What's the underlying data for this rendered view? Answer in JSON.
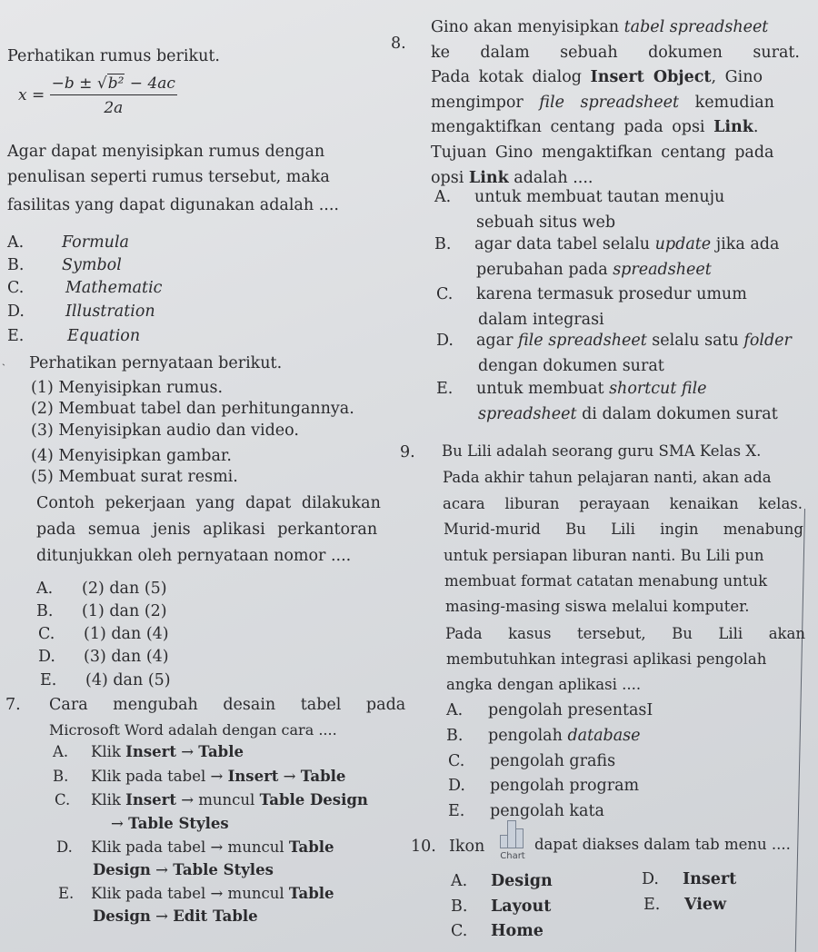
{
  "q6_intro": {
    "prompt": "Perhatikan rumus berikut.",
    "formula": {
      "lhs": "x =",
      "numerator_pre": "−b ± ",
      "sqrt_term": "b²",
      "numerator_post": " − 4ac",
      "denominator": "2a"
    },
    "question_lines": [
      "Agar dapat menyisipkan rumus dengan",
      "penulisan seperti rumus tersebut, maka",
      "fasilitas yang dapat digunakan adalah ...."
    ],
    "options": [
      {
        "letter": "A.",
        "text": "Formula"
      },
      {
        "letter": "B.",
        "text": "Symbol"
      },
      {
        "letter": "C.",
        "text": "Mathematic"
      },
      {
        "letter": "D.",
        "text": "Illustration"
      },
      {
        "letter": "E.",
        "text": "Equation"
      }
    ]
  },
  "q6": {
    "number": "ˎ",
    "prompt": "Perhatikan pernyataan berikut.",
    "statements": [
      "(1)  Menyisipkan rumus.",
      "(2)  Membuat tabel dan perhitungannya.",
      "(3)  Menyisipkan audio dan video.",
      "(4)  Menyisipkan gambar.",
      "(5)  Membuat surat resmi."
    ],
    "question_lines": [
      "Contoh pekerjaan yang dapat dilakukan",
      "pada semua jenis aplikasi perkantoran",
      "ditunjukkan oleh pernyataan nomor ...."
    ],
    "options": [
      {
        "letter": "A.",
        "text": "(2) dan (5)"
      },
      {
        "letter": "B.",
        "text": "(1) dan (2)"
      },
      {
        "letter": "C.",
        "text": "(1) dan (4)"
      },
      {
        "letter": "D.",
        "text": "(3) dan (4)"
      },
      {
        "letter": "E.",
        "text": "(4) dan (5)"
      }
    ]
  },
  "q7": {
    "number": "7.",
    "question_lines": [
      "Cara mengubah desain tabel pada",
      "Microsoft Word adalah dengan cara ...."
    ],
    "options": [
      {
        "letter": "A.",
        "parts": [
          "Klik ",
          "Insert",
          " → ",
          "Table"
        ]
      },
      {
        "letter": "B.",
        "parts": [
          "Klik pada tabel → ",
          "Insert",
          " → ",
          "Table"
        ]
      },
      {
        "letter": "C.",
        "parts": [
          "Klik ",
          "Insert",
          " → muncul ",
          "Table Design"
        ],
        "cont": [
          "→ ",
          "Table Styles"
        ]
      },
      {
        "letter": "D.",
        "parts": [
          "Klik pada tabel → muncul ",
          "Table"
        ],
        "cont": [
          "Design",
          " → ",
          "Table Styles"
        ]
      },
      {
        "letter": "E.",
        "parts": [
          "Klik pada tabel → muncul ",
          "Table"
        ],
        "cont": [
          "Design",
          " → ",
          "Edit Table"
        ]
      }
    ]
  },
  "q8": {
    "number": "8.",
    "lines": [
      [
        "Gino akan menyisipkan ",
        "tabel spreadsheet"
      ],
      [
        "ke",
        "dalam",
        "sebuah",
        "dokumen",
        "surat."
      ],
      [
        "Pada kotak dialog ",
        "Insert Object",
        ", Gino"
      ],
      [
        "mengimpor ",
        "file spreadsheet",
        " kemudian"
      ],
      [
        "mengaktifkan centang pada opsi ",
        "Link",
        "."
      ],
      [
        "Tujuan Gino mengaktifkan centang pada"
      ],
      [
        "opsi ",
        "Link",
        " adalah ...."
      ]
    ],
    "options": [
      {
        "letter": "A.",
        "l1": "untuk membuat tautan menuju",
        "l2": "sebuah situs web"
      },
      {
        "letter": "B.",
        "l1a": "agar data tabel selalu ",
        "l1i": "update",
        "l1b": " jika ada",
        "l2a": "perubahan pada ",
        "l2i": "spreadsheet"
      },
      {
        "letter": "C.",
        "l1": "karena termasuk prosedur umum",
        "l2": "dalam integrasi"
      },
      {
        "letter": "D.",
        "l1a": "agar ",
        "l1i": "file spreadsheet",
        "l1b": " selalu satu ",
        "l1i2": "folder",
        "l2": "dengan dokumen surat"
      },
      {
        "letter": "E.",
        "l1a": "untuk membuat ",
        "l1i": "shortcut file",
        "l2i": "spreadsheet",
        "l2b": " di dalam dokumen surat"
      }
    ]
  },
  "q9": {
    "number": "9.",
    "lines": [
      "Bu Lili adalah seorang guru SMA Kelas X.",
      "Pada akhir tahun pelajaran nanti, akan ada",
      "acara liburan perayaan kenaikan kelas.",
      "Murid-murid Bu Lili ingin menabung",
      "untuk persiapan liburan nanti. Bu Lili pun",
      "membuat format catatan menabung untuk",
      "masing-masing siswa melalui komputer.",
      "Pada kasus tersebut, Bu Lili akan",
      "membutuhkan integrasi aplikasi pengolah",
      "angka dengan aplikasi ...."
    ],
    "options": [
      {
        "letter": "A.",
        "text": "pengolah presentasI"
      },
      {
        "letter": "B.",
        "text": "pengolah ",
        "italic": "database"
      },
      {
        "letter": "C.",
        "text": "pengolah grafis"
      },
      {
        "letter": "D.",
        "text": "pengolah program"
      },
      {
        "letter": "E.",
        "text": "pengolah kata"
      }
    ]
  },
  "q10": {
    "number": "10.",
    "pre": "Ikon",
    "icon_label": "Chart",
    "post": "dapat diakses dalam tab menu ....",
    "options": [
      {
        "letter": "A.",
        "text": "Design"
      },
      {
        "letter": "B.",
        "text": "Layout"
      },
      {
        "letter": "C.",
        "text": "Home"
      },
      {
        "letter": "D.",
        "text": "Insert"
      },
      {
        "letter": "E.",
        "text": "View"
      }
    ]
  }
}
